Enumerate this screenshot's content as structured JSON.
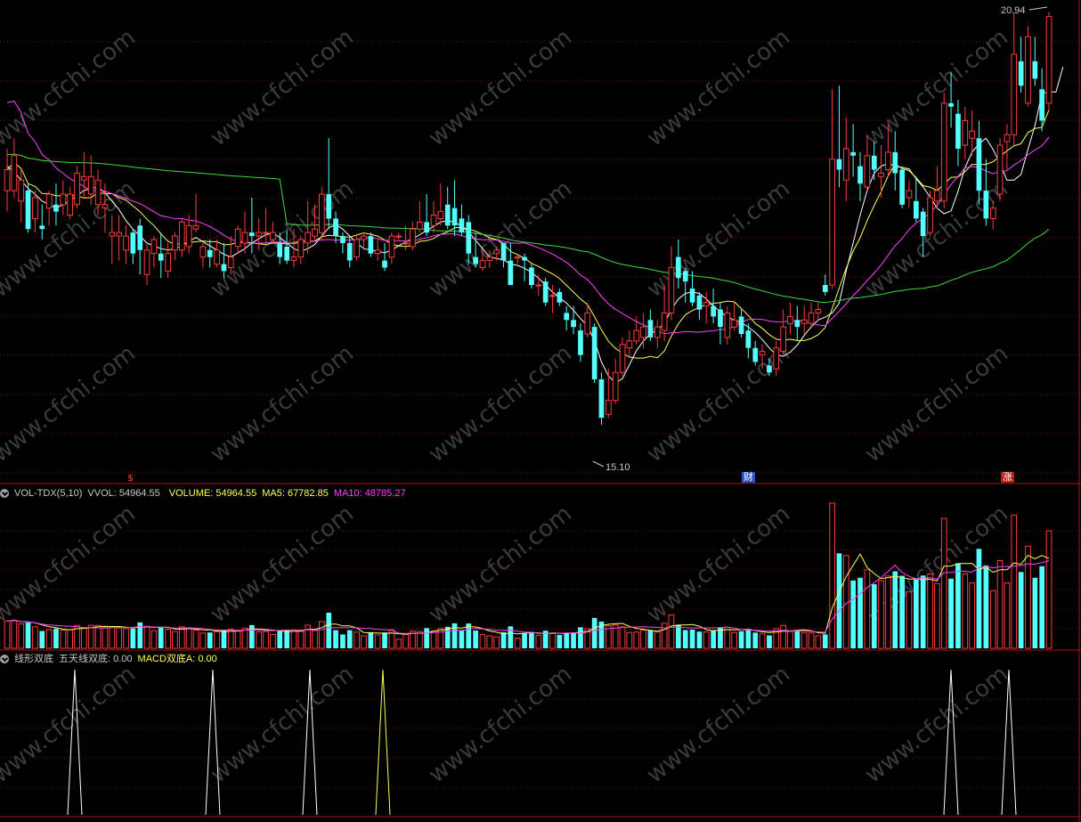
{
  "colors": {
    "up": "#ff3b3b",
    "down": "#54ffff",
    "ma_white": "#ffffff",
    "ma_yellow": "#ffff54",
    "ma_magenta": "#ff40ff",
    "ma_green": "#3ddc3d",
    "grid": "#8b0000",
    "label_grey": "#c8c8c8",
    "signal_white": "#ffffff",
    "signal_yellow": "#ffff54"
  },
  "price_panel": {
    "high_label": "20.94",
    "low_label": "15.10",
    "markers": [
      {
        "text": "$",
        "color": "#ff3b3b"
      },
      {
        "text": "财",
        "color": "#ffffff",
        "bg": "#2a52c9"
      },
      {
        "text": "涨",
        "color": "#ffffff",
        "bg": "#c01818"
      }
    ]
  },
  "volume_panel": {
    "header": [
      {
        "text": "VOL-TDX(5,10)",
        "color": "#c8c8c8"
      },
      {
        "text": "VVOL: 54964.55",
        "color": "#c8c8c8"
      },
      {
        "text": "VOLUME: 54964.55",
        "color": "#ffff54"
      },
      {
        "text": "MA5: 67782.85",
        "color": "#ffff54"
      },
      {
        "text": "MA10: 48785.27",
        "color": "#ff40ff"
      }
    ]
  },
  "signal_panel": {
    "header": [
      {
        "text": "线形双底",
        "color": "#c8c8c8"
      },
      {
        "text": "五天线双底: 0.00",
        "color": "#c8c8c8"
      },
      {
        "text": "MACD双底A: 0.00",
        "color": "#ffff54"
      }
    ]
  },
  "watermark": "www.cfchi.com",
  "chart_data": {
    "type": "candlestick",
    "price_range": [
      14.4,
      21.1
    ],
    "candles": [
      [
        18.45,
        18.75,
        18.15,
        19.05
      ],
      [
        18.45,
        18.95,
        18.35,
        19.2
      ],
      [
        18.3,
        18.6,
        18.0,
        18.75
      ],
      [
        18.45,
        17.9,
        17.85,
        18.55
      ],
      [
        18.05,
        18.35,
        17.85,
        18.45
      ],
      [
        17.95,
        17.9,
        17.75,
        18.25
      ],
      [
        18.2,
        18.4,
        17.95,
        18.45
      ],
      [
        18.25,
        18.15,
        17.95,
        18.55
      ],
      [
        18.25,
        18.4,
        18.1,
        18.6
      ],
      [
        18.1,
        18.4,
        18.05,
        18.5
      ],
      [
        18.25,
        18.7,
        18.2,
        18.8
      ],
      [
        18.6,
        18.65,
        18.35,
        19.0
      ],
      [
        18.4,
        18.65,
        18.25,
        18.95
      ],
      [
        18.25,
        18.6,
        18.1,
        18.75
      ],
      [
        18.2,
        18.25,
        17.85,
        18.55
      ],
      [
        17.8,
        17.85,
        17.4,
        18.1
      ],
      [
        17.8,
        17.85,
        17.45,
        18.1
      ],
      [
        17.6,
        17.8,
        17.4,
        17.95
      ],
      [
        17.85,
        17.55,
        17.4,
        17.9
      ],
      [
        17.95,
        17.6,
        17.25,
        18.05
      ],
      [
        17.25,
        17.6,
        17.1,
        17.7
      ],
      [
        17.55,
        17.75,
        17.35,
        17.8
      ],
      [
        17.55,
        17.45,
        17.2,
        17.85
      ],
      [
        17.3,
        17.55,
        17.2,
        17.7
      ],
      [
        17.6,
        17.8,
        17.45,
        17.85
      ],
      [
        17.6,
        18.0,
        17.5,
        18.05
      ],
      [
        17.65,
        17.95,
        17.55,
        18.1
      ],
      [
        17.9,
        17.95,
        17.85,
        18.4
      ],
      [
        17.5,
        17.65,
        17.35,
        17.7
      ],
      [
        17.6,
        17.5,
        17.35,
        17.75
      ],
      [
        17.4,
        17.6,
        17.35,
        17.75
      ],
      [
        17.4,
        17.3,
        17.2,
        17.7
      ],
      [
        17.35,
        17.5,
        17.25,
        17.8
      ],
      [
        17.65,
        17.9,
        17.55,
        17.95
      ],
      [
        17.7,
        17.85,
        17.55,
        18.15
      ],
      [
        17.85,
        17.8,
        17.55,
        18.35
      ],
      [
        17.8,
        17.85,
        17.6,
        18.05
      ],
      [
        17.85,
        17.85,
        17.7,
        18.2
      ],
      [
        17.75,
        17.85,
        17.7,
        18.0
      ],
      [
        17.7,
        17.5,
        17.4,
        17.85
      ],
      [
        17.65,
        17.45,
        17.4,
        17.9
      ],
      [
        17.45,
        17.5,
        17.35,
        17.9
      ],
      [
        17.5,
        17.75,
        17.4,
        17.8
      ],
      [
        17.7,
        17.85,
        17.55,
        18.3
      ],
      [
        17.8,
        17.9,
        17.75,
        18.25
      ],
      [
        17.85,
        18.4,
        17.75,
        18.5
      ],
      [
        18.4,
        18.05,
        17.9,
        19.2
      ],
      [
        18.05,
        17.8,
        17.7,
        18.15
      ],
      [
        17.8,
        17.7,
        17.55,
        17.85
      ],
      [
        17.7,
        17.45,
        17.35,
        17.8
      ],
      [
        17.5,
        17.75,
        17.45,
        17.8
      ],
      [
        17.75,
        17.8,
        17.6,
        17.85
      ],
      [
        17.8,
        17.55,
        17.5,
        17.85
      ],
      [
        17.55,
        17.6,
        17.45,
        17.75
      ],
      [
        17.45,
        17.35,
        17.3,
        17.7
      ],
      [
        17.5,
        17.8,
        17.4,
        17.85
      ],
      [
        17.8,
        17.8,
        17.75,
        17.85
      ],
      [
        17.7,
        17.7,
        17.6,
        17.95
      ],
      [
        17.65,
        17.9,
        17.6,
        18.0
      ],
      [
        17.9,
        18.0,
        17.85,
        18.3
      ],
      [
        18.0,
        17.85,
        17.8,
        18.4
      ],
      [
        17.95,
        18.1,
        17.85,
        18.3
      ],
      [
        18.05,
        18.15,
        17.95,
        18.55
      ],
      [
        18.25,
        17.95,
        17.9,
        18.5
      ],
      [
        18.2,
        17.95,
        17.8,
        18.6
      ],
      [
        18.05,
        17.85,
        17.8,
        18.25
      ],
      [
        18.0,
        17.55,
        17.4,
        18.1
      ],
      [
        17.5,
        17.4,
        17.35,
        17.85
      ],
      [
        17.35,
        17.45,
        17.3,
        17.6
      ],
      [
        17.45,
        17.5,
        17.35,
        17.6
      ],
      [
        17.55,
        17.6,
        17.45,
        17.65
      ],
      [
        17.7,
        17.45,
        17.35,
        17.7
      ],
      [
        17.45,
        17.1,
        17.1,
        17.7
      ],
      [
        17.5,
        17.5,
        17.4,
        17.55
      ],
      [
        17.5,
        17.45,
        17.15,
        17.55
      ],
      [
        17.35,
        17.1,
        17.05,
        17.4
      ],
      [
        17.1,
        17.1,
        16.95,
        17.25
      ],
      [
        17.15,
        16.85,
        16.8,
        17.2
      ],
      [
        16.95,
        16.95,
        16.7,
        17.1
      ],
      [
        17.0,
        16.85,
        16.8,
        17.05
      ],
      [
        16.7,
        16.6,
        16.45,
        16.8
      ],
      [
        16.6,
        16.5,
        16.4,
        16.8
      ],
      [
        16.45,
        16.1,
        16.0,
        16.55
      ],
      [
        16.4,
        16.7,
        16.35,
        16.85
      ],
      [
        16.5,
        15.75,
        15.7,
        16.55
      ],
      [
        15.75,
        15.2,
        15.1,
        15.85
      ],
      [
        15.25,
        15.45,
        15.2,
        15.9
      ],
      [
        15.45,
        15.85,
        15.4,
        16.05
      ],
      [
        15.85,
        16.25,
        15.8,
        16.35
      ],
      [
        16.2,
        16.3,
        16.05,
        16.45
      ],
      [
        16.3,
        16.45,
        16.25,
        16.65
      ],
      [
        16.35,
        16.5,
        16.2,
        16.7
      ],
      [
        16.6,
        16.35,
        16.3,
        16.75
      ],
      [
        16.35,
        16.5,
        16.2,
        16.6
      ],
      [
        16.45,
        16.7,
        16.3,
        17.1
      ],
      [
        16.7,
        17.35,
        16.6,
        17.65
      ],
      [
        17.5,
        17.2,
        17.05,
        17.75
      ],
      [
        17.3,
        17.15,
        16.85,
        17.35
      ],
      [
        17.05,
        16.85,
        16.8,
        17.3
      ],
      [
        16.95,
        16.75,
        16.6,
        17.0
      ],
      [
        16.8,
        16.85,
        16.55,
        17.0
      ],
      [
        16.8,
        16.65,
        16.55,
        17.05
      ],
      [
        16.75,
        16.5,
        16.25,
        16.85
      ],
      [
        16.35,
        16.7,
        16.25,
        16.8
      ],
      [
        16.5,
        16.6,
        16.45,
        16.85
      ],
      [
        16.65,
        16.4,
        16.35,
        16.75
      ],
      [
        16.45,
        16.2,
        16.05,
        16.55
      ],
      [
        16.2,
        16.0,
        15.95,
        16.3
      ],
      [
        16.1,
        16.15,
        15.9,
        16.25
      ],
      [
        15.95,
        15.85,
        15.8,
        16.05
      ],
      [
        15.9,
        16.2,
        15.8,
        16.3
      ],
      [
        16.15,
        16.5,
        16.1,
        16.75
      ],
      [
        16.55,
        16.65,
        16.4,
        16.85
      ],
      [
        16.6,
        16.5,
        16.3,
        16.8
      ],
      [
        16.55,
        16.6,
        16.4,
        16.8
      ],
      [
        16.55,
        16.7,
        16.5,
        16.85
      ],
      [
        16.7,
        16.75,
        16.6,
        16.85
      ],
      [
        17.1,
        17.0,
        16.95,
        17.25
      ],
      [
        17.1,
        18.9,
        17.05,
        19.9
      ],
      [
        18.9,
        18.75,
        18.5,
        19.95
      ],
      [
        18.6,
        19.05,
        18.3,
        19.5
      ],
      [
        19.0,
        18.95,
        18.65,
        19.4
      ],
      [
        18.8,
        18.55,
        18.3,
        19.0
      ],
      [
        18.5,
        18.95,
        18.45,
        19.25
      ],
      [
        18.95,
        18.75,
        18.6,
        19.15
      ],
      [
        18.65,
        18.7,
        18.35,
        19.1
      ],
      [
        18.75,
        19.0,
        18.65,
        19.4
      ],
      [
        19.0,
        18.7,
        18.45,
        19.3
      ],
      [
        18.75,
        18.25,
        18.2,
        18.8
      ],
      [
        18.35,
        18.45,
        18.2,
        18.6
      ],
      [
        18.3,
        18.05,
        18.0,
        18.65
      ],
      [
        18.15,
        17.8,
        17.5,
        18.2
      ],
      [
        17.85,
        18.35,
        17.8,
        18.45
      ],
      [
        18.3,
        18.45,
        18.2,
        18.8
      ],
      [
        18.3,
        19.7,
        18.2,
        19.85
      ],
      [
        19.7,
        19.65,
        19.35,
        20.15
      ],
      [
        19.55,
        19.05,
        18.8,
        19.75
      ],
      [
        19.1,
        19.45,
        18.9,
        19.65
      ],
      [
        19.2,
        19.3,
        18.95,
        19.6
      ],
      [
        19.2,
        18.45,
        18.25,
        19.45
      ],
      [
        18.45,
        18.05,
        17.95,
        18.9
      ],
      [
        18.05,
        18.2,
        17.9,
        18.3
      ],
      [
        18.4,
        19.1,
        18.3,
        19.2
      ],
      [
        19.15,
        19.25,
        18.75,
        19.4
      ],
      [
        19.25,
        20.4,
        19.1,
        21.0
      ],
      [
        20.3,
        19.95,
        19.85,
        20.65
      ],
      [
        19.7,
        20.65,
        19.65,
        20.8
      ],
      [
        20.3,
        20.05,
        19.95,
        20.65
      ],
      [
        19.9,
        19.45,
        19.3,
        20.2
      ],
      [
        19.7,
        20.94,
        19.6,
        21.0
      ]
    ],
    "ma_white": [
      18.8,
      18.72,
      18.6,
      18.48,
      18.4,
      18.3,
      18.25,
      18.2,
      18.25,
      18.3,
      18.38,
      18.45,
      18.48,
      18.5,
      18.42,
      18.3,
      18.18,
      18.02,
      17.9,
      17.8,
      17.7,
      17.66,
      17.62,
      17.6,
      17.62,
      17.66,
      17.72,
      17.78,
      17.72,
      17.66,
      17.6,
      17.54,
      17.5,
      17.56,
      17.62,
      17.7,
      17.76,
      17.82,
      17.84,
      17.78,
      17.7,
      17.62,
      17.58,
      17.62,
      17.68,
      17.8,
      17.92,
      17.96,
      17.9,
      17.8,
      17.7,
      17.62,
      17.6,
      17.58,
      17.56,
      17.6,
      17.66,
      17.72,
      17.76,
      17.82,
      17.88,
      17.94,
      18.0,
      18.02,
      18.0,
      17.94,
      17.86,
      17.74,
      17.62,
      17.5,
      17.48,
      17.46,
      17.4,
      17.38,
      17.34,
      17.28,
      17.2,
      17.1,
      17.0,
      16.92,
      16.84,
      16.74,
      16.62,
      16.52,
      16.3,
      16.0,
      15.8,
      15.7,
      15.76,
      15.96,
      16.16,
      16.3,
      16.4,
      16.46,
      16.55,
      16.75,
      16.9,
      16.98,
      17.0,
      16.98,
      16.9,
      16.8,
      16.72,
      16.64,
      16.6,
      16.56,
      16.5,
      16.42,
      16.32,
      16.2,
      16.1,
      16.08,
      16.14,
      16.24,
      16.38,
      16.5,
      16.6,
      16.64,
      16.7,
      16.84,
      17.3,
      17.7,
      18.1,
      18.45,
      18.7,
      18.8,
      18.84,
      18.8,
      18.78,
      18.76,
      18.62,
      18.5,
      18.36,
      18.2,
      18.12,
      18.16,
      18.44,
      18.78,
      19.0,
      19.12,
      19.2,
      19.04,
      18.84,
      18.6,
      18.6,
      18.68,
      19.04,
      19.38,
      19.84,
      19.86,
      19.86,
      20.22
    ]
  }
}
